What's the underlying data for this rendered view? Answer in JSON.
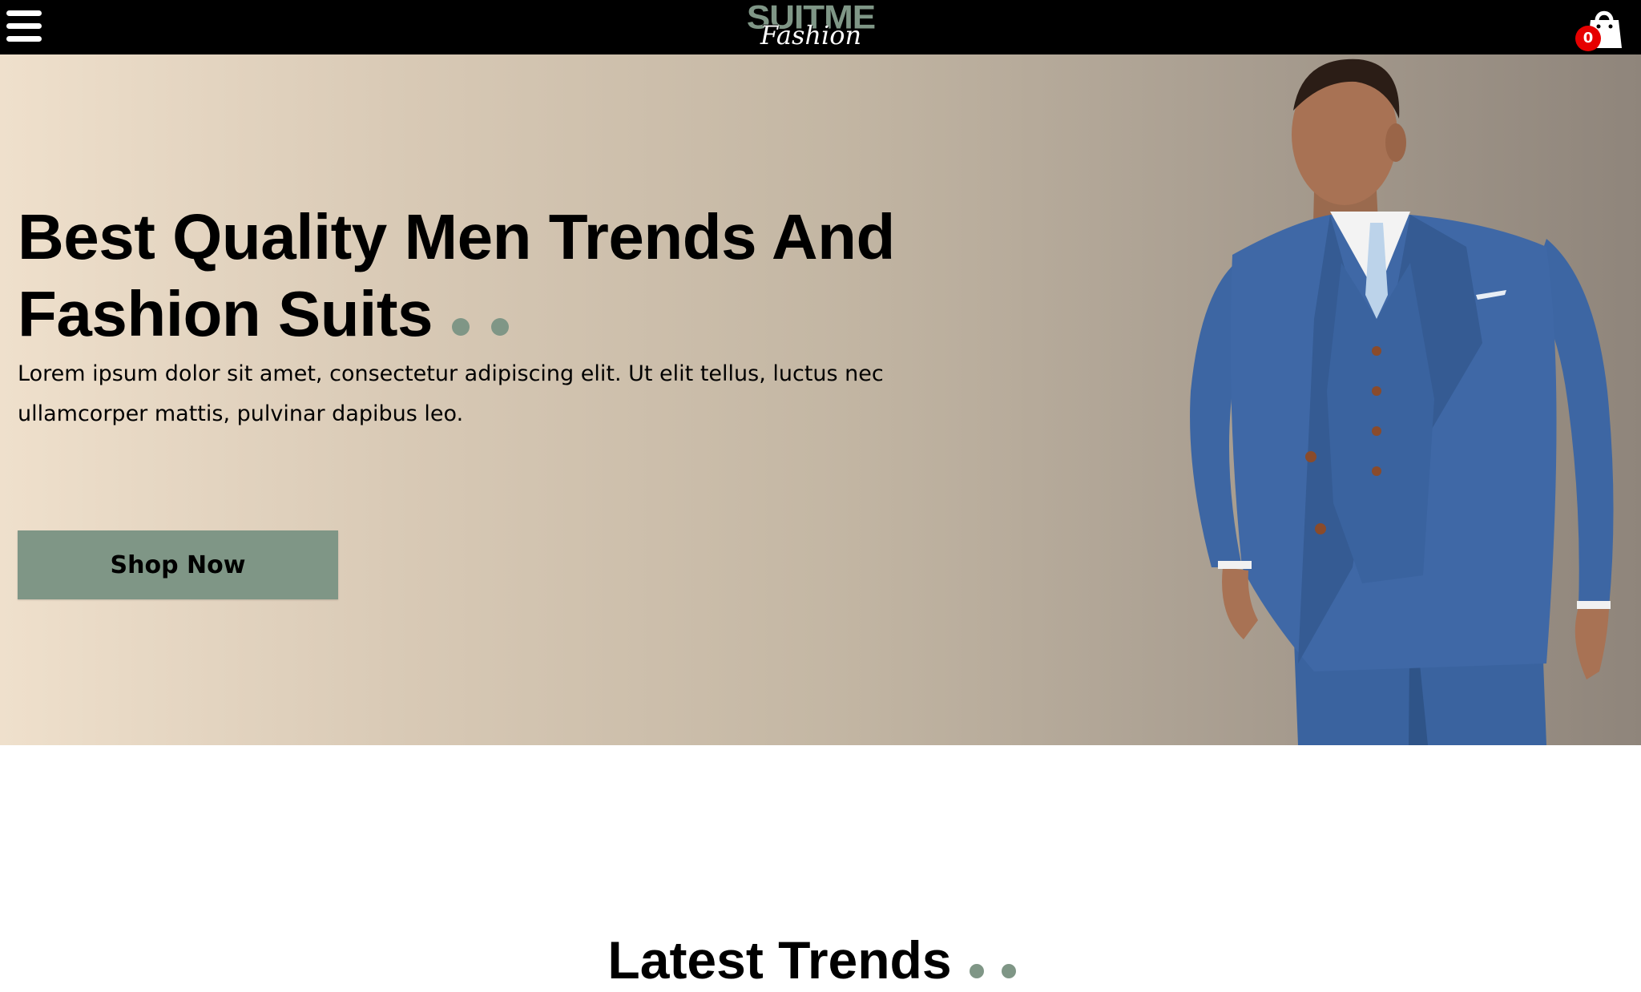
{
  "header": {
    "logo_top": "SUITME",
    "logo_bottom": "Fashion",
    "cart_count": "0",
    "menu_icon": "hamburger-menu-icon",
    "cart_icon": "shopping-bag-icon"
  },
  "hero": {
    "title": "Best Quality Men Trends And Fashion Suits",
    "description": "Lorem ipsum dolor sit amet, consectetur adipiscing elit. Ut elit tellus, luctus nec ullamcorper mattis, pulvinar dapibus leo.",
    "button_label": "Shop Now"
  },
  "section": {
    "title": "Latest Trends"
  },
  "colors": {
    "accent": "#7f9686",
    "header_bg": "#000000",
    "badge": "#e60000",
    "suit": "#3f68a6"
  }
}
